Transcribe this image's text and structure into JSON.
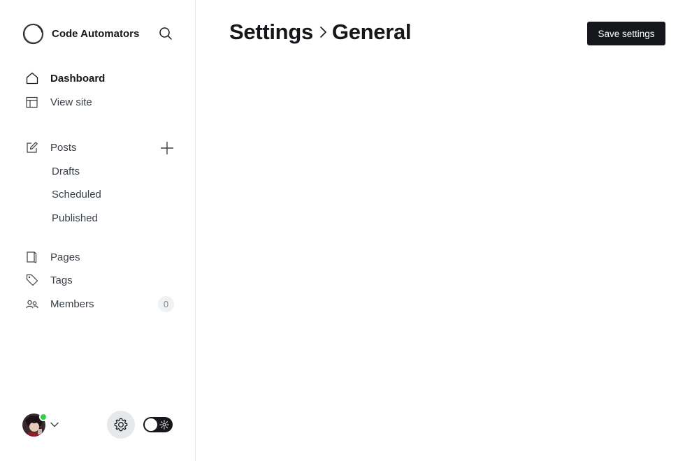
{
  "app": {
    "site_name": "Code Automators"
  },
  "sidebar": {
    "primary": [
      {
        "label": "Dashboard",
        "icon": "home-icon",
        "active": true
      },
      {
        "label": "View site",
        "icon": "layout-icon"
      }
    ],
    "posts": {
      "label": "Posts",
      "icon": "pencil-icon",
      "add_icon": "plus-icon",
      "children": [
        {
          "label": "Drafts"
        },
        {
          "label": "Scheduled"
        },
        {
          "label": "Published"
        }
      ]
    },
    "secondary": [
      {
        "label": "Pages",
        "icon": "page-icon"
      },
      {
        "label": "Tags",
        "icon": "tag-icon"
      },
      {
        "label": "Members",
        "icon": "members-icon",
        "count": "0"
      }
    ],
    "footer": {
      "status_color": "#30cf43",
      "settings_icon": "gear-icon",
      "theme_toggle": "dark",
      "theme_icon": "sun-icon"
    }
  },
  "header": {
    "breadcrumb": [
      {
        "label": "Settings"
      },
      {
        "label": "General"
      }
    ],
    "save_label": "Save settings"
  },
  "colors": {
    "primary_button": "#15171a",
    "online": "#30cf43",
    "border": "#e6e9eb"
  }
}
